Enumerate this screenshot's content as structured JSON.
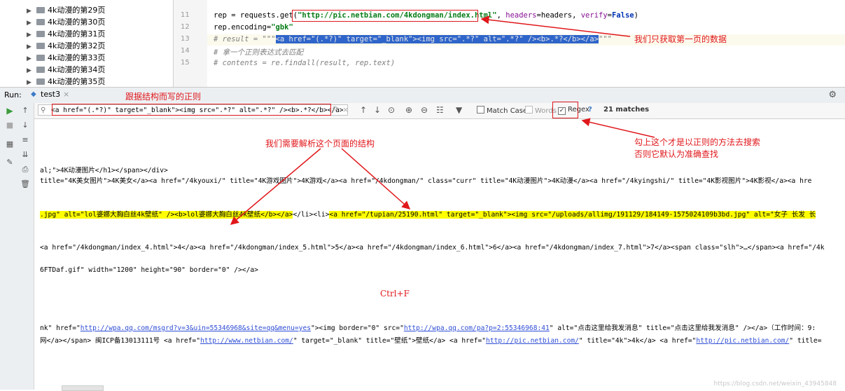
{
  "tree": {
    "items": [
      "4k动漫的第29页",
      "4k动漫的第30页",
      "4k动漫的第31页",
      "4k动漫的第32页",
      "4k动漫的第33页",
      "4k动漫的第34页",
      "4k动漫的第35页"
    ]
  },
  "editor": {
    "lines": [
      {
        "num": "11",
        "parts": [
          {
            "t": "rep = requests.get(",
            "c": ""
          },
          {
            "t": "\"http://pic.netbian.com/4kdongman/index.html\"",
            "c": "str"
          },
          {
            "t": ", ",
            "c": ""
          },
          {
            "t": "headers",
            "c": "param"
          },
          {
            "t": "=headers, ",
            "c": ""
          },
          {
            "t": "verify",
            "c": "param"
          },
          {
            "t": "=",
            "c": ""
          },
          {
            "t": "False",
            "c": "kw"
          },
          {
            "t": ")",
            "c": ""
          }
        ]
      },
      {
        "num": "12",
        "parts": [
          {
            "t": "rep.encoding=",
            "c": ""
          },
          {
            "t": "\"gbk\"",
            "c": "str"
          }
        ]
      },
      {
        "num": "13",
        "parts": [
          {
            "t": "# result = \"\"\"",
            "c": "comment"
          },
          {
            "t": "<a href=\"(.*?)\" target=\"_blank\"><img src=\".*?\" alt=\".*?\" /><b>.*?</b></a>",
            "c": "sel"
          },
          {
            "t": "\"\"\"",
            "c": "comment"
          }
        ]
      },
      {
        "num": "14",
        "parts": [
          {
            "t": "# 拿一个正则表达式去匹配",
            "c": "comment"
          }
        ]
      },
      {
        "num": "15",
        "parts": [
          {
            "t": "# contents = re.findall(result, rep.text)",
            "c": "comment"
          }
        ]
      }
    ]
  },
  "runbar": {
    "run_label": "Run:",
    "tab_label": "test3",
    "close": "×"
  },
  "search": {
    "query": "<a href=\"(.*?)\" target=\"_blank\"><img src=\".*?\" alt=\".*?\" /><b>.*?</b></a>",
    "match_case": "Match Case",
    "words": "Words",
    "regex": "Regex",
    "help": "?",
    "matches": "21 matches"
  },
  "console": {
    "line1": "al;\">4K动漫图片</h1></span></div>",
    "line2": "title=\"4K美女图片\">4K美女</a><a href=\"/4kyouxi/\" title=\"4K游戏图片\">4K游戏</a><a href=\"/4kdongman/\" class=\"curr\" title=\"4K动漫图片\">4K动漫</a><a href=\"/4kyingshi/\" title=\"4K影视图片\">4K影视</a><a hre",
    "line3_a": ".jpg\" alt=\"lol婆娜大胸白丝4k壁纸\" /><b>lol婆娜大胸白丝4k壁纸</b></a>",
    "line3_b": "</li><li>",
    "line3_c": "<a href=\"/tupian/25190.html\" target=\"_blank\"><img src=\"/uploads/allimg/191129/184149-1575024109b3bd.jpg\" alt=\"女子 长发 长",
    "line4": "<a href=\"/4kdongman/index_4.html\">4</a><a href=\"/4kdongman/index_5.html\">5</a><a href=\"/4kdongman/index_6.html\">6</a><a href=\"/4kdongman/index_7.html\">7</a><span class=\"slh\">…</span><a href=\"/4k",
    "line5": "6FTDaf.gif\" width=\"1200\" height=\"90\" border=\"0\" /></a>",
    "line6_a": "nk\" href=\"",
    "line6_link1": "http://wpa.qq.com/msgrd?v=3&uin=55346968&site=qq&menu=yes",
    "line6_b": "\"><img border=\"0\" src=\"",
    "line6_link2": "http://wpa.qq.com/pa?p=2:55346968:41",
    "line6_c": "\" alt=\"点击这里给我发消息\" title=\"点击这里给我发消息\" /></a>（工作时间：9:",
    "line7_a": "网</a></span> 闽ICP备13013111号 <a href=\"",
    "line7_link1": "http://www.netbian.com/",
    "line7_b": "\" target=\"_blank\" title=\"壁纸\">壁纸</a> <a href=\"",
    "line7_link2": "http://pic.netbian.com/",
    "line7_c": "\" title=\"4k\">4k</a> <a href=\"",
    "line7_link3": "http://pic.netbian.com/",
    "line7_d": "\" title="
  },
  "annotations": {
    "first_page": "我们只获取第一页的数据",
    "regex_by_structure": "跟据结构而写的正则",
    "parse_structure": "我们需要解析这个页面的结构",
    "regex_note_1": "勾上这个才是以正则的方法去搜索",
    "regex_note_2": "否则它默认为准确查找",
    "ctrl_f": "Ctrl+F"
  },
  "watermark": "https://blog.csdn.net/weixin_43945848",
  "colors": {
    "annotation": "#e0171b",
    "highlight": "#ffff00",
    "selection": "#2f65ca",
    "link": "#2f4ed5"
  }
}
